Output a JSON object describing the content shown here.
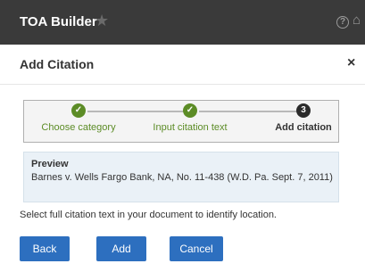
{
  "app": {
    "title": "TOA Builder",
    "icons": [
      "star-icon",
      "help-icon",
      "home-icon"
    ]
  },
  "dialog": {
    "title": "Add Citation",
    "close_label": "×"
  },
  "steps": [
    {
      "label": "Choose category",
      "state": "done",
      "marker": "✓"
    },
    {
      "label": "Input citation text",
      "state": "done",
      "marker": "✓"
    },
    {
      "label": "Add citation",
      "state": "current",
      "marker": "3"
    }
  ],
  "preview": {
    "title": "Preview",
    "text": "Barnes v. Wells Fargo Bank, NA, No. 11-438 (W.D. Pa. Sept. 7, 2011)"
  },
  "instructions": "Select full citation text in your document to identify location.",
  "buttons": {
    "back": "Back",
    "add": "Add",
    "cancel": "Cancel"
  },
  "colors": {
    "titlebar": "#3a3a3a",
    "accent_green": "#5c8c26",
    "button_blue": "#2d6fbf",
    "preview_bg": "#eaf1f7"
  }
}
